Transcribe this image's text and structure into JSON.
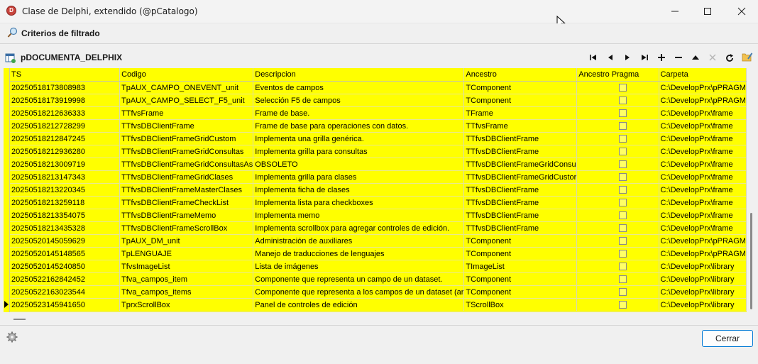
{
  "window": {
    "title": "Clase de Delphi, extendido (@pCatalogo)",
    "app_icon_letter": "D"
  },
  "filter": {
    "label": "Criterios de filtrado"
  },
  "grid": {
    "title": "pDOCUMENTA_DELPHIX",
    "columns": [
      "TS",
      "Codigo",
      "Descripcion",
      "Ancestro",
      "Ancestro Pragma",
      "Carpeta"
    ],
    "rows": [
      {
        "ts": "20250518173808983",
        "codigo": "TpAUX_CAMPO_ONEVENT_unit",
        "descripcion": "Eventos de campos",
        "ancestro": "TComponent",
        "carpeta": "C:\\DevelopPrx\\pPRAGM"
      },
      {
        "ts": "20250518173919998",
        "codigo": "TpAUX_CAMPO_SELECT_F5_unit",
        "descripcion": "Selección F5 de campos",
        "ancestro": "TComponent",
        "carpeta": "C:\\DevelopPrx\\pPRAGM"
      },
      {
        "ts": "20250518212636333",
        "codigo": "TTfvsFrame",
        "descripcion": "Frame de base.",
        "ancestro": "TFrame",
        "carpeta": "C:\\DevelopPrx\\frame"
      },
      {
        "ts": "20250518212728299",
        "codigo": "TTfvsDBClientFrame",
        "descripcion": "Frame de base para operaciones con datos.",
        "ancestro": "TTfvsFrame",
        "carpeta": "C:\\DevelopPrx\\frame"
      },
      {
        "ts": "20250518212847245",
        "codigo": "TTfvsDBClientFrameGridCustom",
        "descripcion": "Implementa una grilla genérica.",
        "ancestro": "TTfvsDBClientFrame",
        "carpeta": "C:\\DevelopPrx\\frame"
      },
      {
        "ts": "20250518212936280",
        "codigo": "TTfvsDBClientFrameGridConsultas",
        "descripcion": "Implementa grilla para consultas",
        "ancestro": "TTfvsDBClientFrame",
        "carpeta": "C:\\DevelopPrx\\frame"
      },
      {
        "ts": "20250518213009719",
        "codigo": "TTfvsDBClientFrameGridConsultasAs",
        "descripcion": "OBSOLETO",
        "ancestro": "TTfvsDBClientFrameGridConsu",
        "carpeta": "C:\\DevelopPrx\\frame"
      },
      {
        "ts": "20250518213147343",
        "codigo": "TTfvsDBClientFrameGridClases",
        "descripcion": "Implementa grilla para clases",
        "ancestro": "TTfvsDBClientFrameGridCustor",
        "carpeta": "C:\\DevelopPrx\\frame"
      },
      {
        "ts": "20250518213220345",
        "codigo": "TTfvsDBClientFrameMasterClases",
        "descripcion": "Implementa ficha de clases",
        "ancestro": "TTfvsDBClientFrame",
        "carpeta": "C:\\DevelopPrx\\frame"
      },
      {
        "ts": "20250518213259118",
        "codigo": "TTfvsDBClientFrameCheckList",
        "descripcion": "Implementa lista para checkboxes",
        "ancestro": "TTfvsDBClientFrame",
        "carpeta": "C:\\DevelopPrx\\frame"
      },
      {
        "ts": "20250518213354075",
        "codigo": "TTfvsDBClientFrameMemo",
        "descripcion": "Implementa memo",
        "ancestro": "TTfvsDBClientFrame",
        "carpeta": "C:\\DevelopPrx\\frame"
      },
      {
        "ts": "20250518213435328",
        "codigo": "TTfvsDBClientFrameScrollBox",
        "descripcion": "Implementa scrollbox para agregar controles de edición.",
        "ancestro": "TTfvsDBClientFrame",
        "carpeta": "C:\\DevelopPrx\\frame"
      },
      {
        "ts": "20250520145059629",
        "codigo": "TpAUX_DM_unit",
        "descripcion": "Administración de auxiliares",
        "ancestro": "TComponent",
        "carpeta": "C:\\DevelopPrx\\pPRAGM"
      },
      {
        "ts": "20250520145148565",
        "codigo": "TpLENGUAJE",
        "descripcion": "Manejo de traducciones de lenguajes",
        "ancestro": "TComponent",
        "carpeta": "C:\\DevelopPrx\\pPRAGM"
      },
      {
        "ts": "20250520145240850",
        "codigo": "TfvsImageList",
        "descripcion": "Lista de imágenes",
        "ancestro": "TImageList",
        "carpeta": "C:\\DevelopPrx\\library"
      },
      {
        "ts": "20250522162842452",
        "codigo": "Tfva_campos_item",
        "descripcion": "Componente que representa un campo de un dataset.",
        "ancestro": "TComponent",
        "carpeta": "C:\\DevelopPrx\\library"
      },
      {
        "ts": "20250522163023544",
        "codigo": "Tfva_campos_items",
        "descripcion": "Componente que representa a los campos de un dataset (ar",
        "ancestro": "TComponent",
        "carpeta": "C:\\DevelopPrx\\library"
      },
      {
        "ts": "20250523145941650",
        "codigo": "TprxScrollBox",
        "descripcion": "Panel de controles de edición",
        "ancestro": "TScrollBox",
        "carpeta": "C:\\DevelopPrx\\library"
      }
    ]
  },
  "footer": {
    "close_label": "Cerrar"
  },
  "colors": {
    "grid_bg": "#ffff00",
    "accent": "#0078d4"
  }
}
